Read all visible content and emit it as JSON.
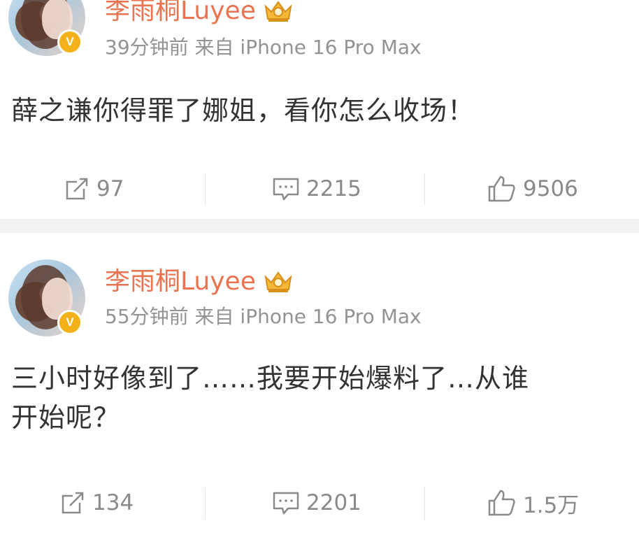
{
  "posts": [
    {
      "username": "李雨桐Luyee",
      "meta": "39分钟前 来自 iPhone 16 Pro Max",
      "verified_mark": "V",
      "content_lines": [
        "薛之谦你得罪了娜姐，看你怎么收场！"
      ],
      "actions": {
        "repost": "97",
        "comment": "2215",
        "like": "9506"
      }
    },
    {
      "username": "李雨桐Luyee",
      "meta": "55分钟前 来自 iPhone 16 Pro Max",
      "verified_mark": "V",
      "content_lines": [
        "三小时好像到了……我要开始爆料了…从谁",
        "开始呢？"
      ],
      "actions": {
        "repost": "134",
        "comment": "2201",
        "like": "1.5万"
      }
    }
  ],
  "colors": {
    "username": "#eb7350",
    "meta": "#939393",
    "content": "#333333",
    "action": "#8a8a8a",
    "verified": "#f4b21a",
    "divider": "#f2f2f2"
  },
  "icons": [
    "crown-badge-icon",
    "repost-icon",
    "comment-icon",
    "like-icon",
    "verified-badge-icon"
  ]
}
